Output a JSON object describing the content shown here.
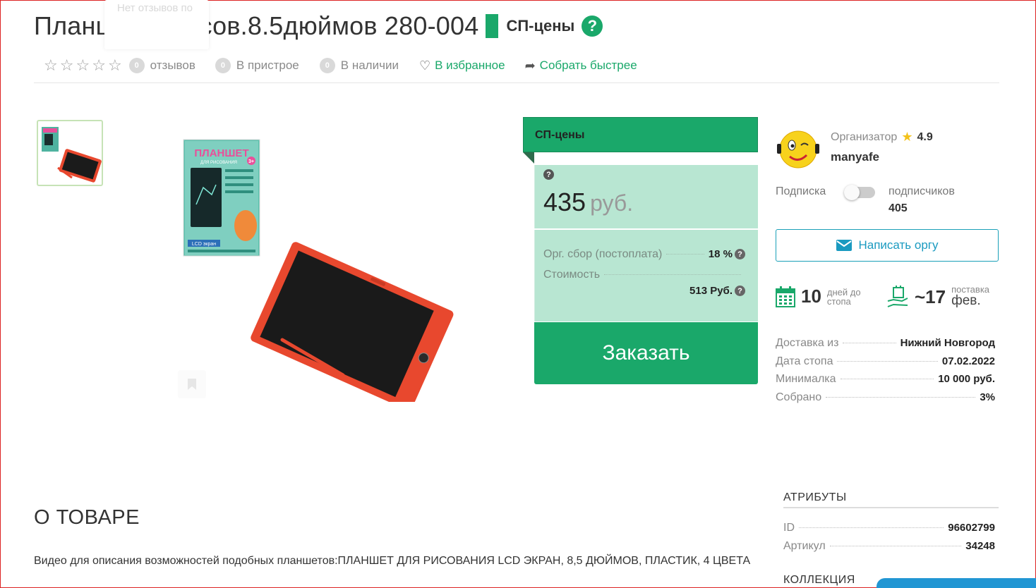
{
  "product": {
    "title": "Планшет д/рисов.8.5дюймов 280-004",
    "price_type": "СП-цены",
    "help_icon": "question-circle-icon",
    "tooltip": "Нет отзывов по"
  },
  "meta": {
    "reviews_count": "0",
    "reviews_label": "отзывов",
    "attach_count": "0",
    "attach_label": "В пристрое",
    "stock_count": "0",
    "stock_label": "В наличии",
    "favorite_label": "В избранное",
    "share_label": "Собрать быстрее",
    "rating_stars": 0
  },
  "price_panel": {
    "header": "СП-цены",
    "price": "435",
    "currency": "руб.",
    "fee_label": "Орг. сбор (постоплата)",
    "fee_value": "18 %",
    "cost_label": "Стоимость",
    "cost_value": "513 Руб.",
    "order_button": "Заказать"
  },
  "organizer": {
    "label": "Организатор",
    "rating": "4.9",
    "name": "manyafe",
    "subscribe_label": "Подписка",
    "subscribers_label": "подписчиков",
    "subscribers_count": "405",
    "write_button": "Написать оргу"
  },
  "stats": {
    "days_value": "10",
    "days_line1": "дней до",
    "days_line2": "стопа",
    "delivery_value": "~17",
    "delivery_label": "поставка",
    "delivery_month": "фев."
  },
  "info": [
    {
      "key": "Доставка из",
      "value": "Нижний Новгород"
    },
    {
      "key": "Дата стопа",
      "value": "07.02.2022"
    },
    {
      "key": "Минималка",
      "value": "10 000 руб."
    },
    {
      "key": "Собрано",
      "value": "3%"
    }
  ],
  "attributes": {
    "title": "АТРИБУТЫ",
    "rows": [
      {
        "key": "ID",
        "value": "96602799"
      },
      {
        "key": "Артикул",
        "value": "34248"
      }
    ],
    "collection_title": "КОЛЛЕКЦИЯ"
  },
  "about": {
    "title": "О ТОВАРЕ",
    "text": "Видео для описания возможностей подобных планшетов:ПЛАНШЕТ ДЛЯ РИСОВАНИЯ LCD ЭКРАН, 8,5 ДЮЙМОВ, ПЛАСТИК, 4 ЦВЕТА"
  },
  "product_image": {
    "box_text_1": "ПЛАНШЕТ",
    "box_text_2": "ДЛЯ РИСОВАНИЯ",
    "box_age": "3+",
    "box_footer": "LCD экран"
  },
  "colors": {
    "accent": "#1aa86a",
    "price_bg": "#b8e6d2",
    "link_blue": "#1a9ac0",
    "tablet_red": "#e8482e"
  }
}
